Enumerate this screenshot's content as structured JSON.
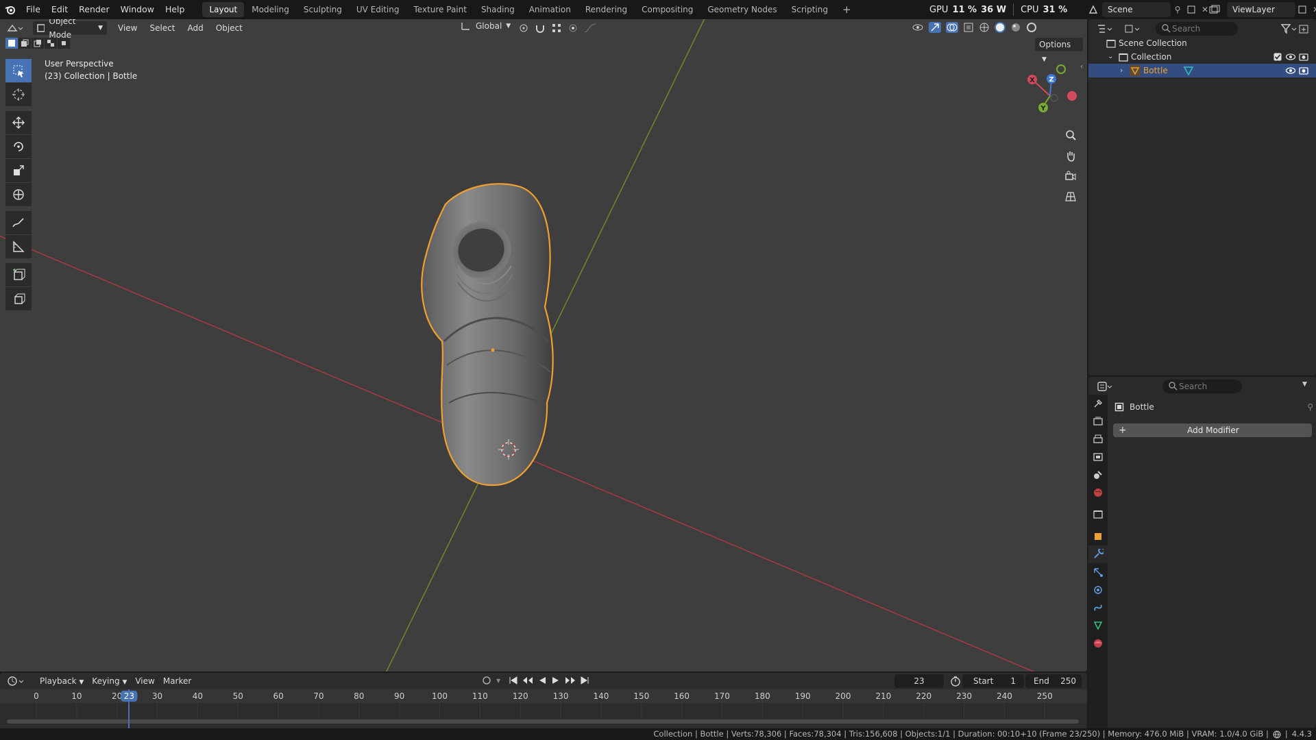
{
  "app": {
    "menus": [
      "File",
      "Edit",
      "Render",
      "Window",
      "Help"
    ],
    "workspaces": [
      "Layout",
      "Modeling",
      "Sculpting",
      "UV Editing",
      "Texture Paint",
      "Shading",
      "Animation",
      "Rendering",
      "Compositing",
      "Geometry Nodes",
      "Scripting"
    ],
    "active_workspace": "Layout",
    "add_workspace": "+",
    "gpu_label": "GPU",
    "gpu_value": "11 %",
    "gpu_power": "36 W",
    "cpu_label": "CPU",
    "cpu_value": "31 %",
    "scene": "Scene",
    "view_layer": "ViewLayer"
  },
  "viewport": {
    "mode": "Object Mode",
    "menus": [
      "View",
      "Select",
      "Add",
      "Object"
    ],
    "orientation": "Global",
    "options": "Options",
    "perspective_label": "User Perspective",
    "context_label": "(23) Collection | Bottle",
    "axis_x_color": "#a83a44",
    "axis_y_color": "#6a8a2a",
    "selection_outline": "#f0a030",
    "gizmo": {
      "x": "X",
      "y": "Y",
      "z": "Z"
    }
  },
  "tools": [
    "select-box-icon",
    "cursor-icon",
    "move-icon",
    "rotate-icon",
    "scale-icon",
    "transform-icon",
    "annotate-icon",
    "measure-icon",
    "add-cube-icon",
    "primitive-icon"
  ],
  "timeline": {
    "menus": [
      "Playback",
      "Keying",
      "View",
      "Marker"
    ],
    "current_frame": "23",
    "start_label": "Start",
    "start_value": "1",
    "end_label": "End",
    "end_value": "250",
    "ticks": [
      "0",
      "10",
      "20",
      "30",
      "40",
      "50",
      "60",
      "70",
      "80",
      "90",
      "100",
      "110",
      "120",
      "130",
      "140",
      "150",
      "160",
      "170",
      "180",
      "190",
      "200",
      "210",
      "220",
      "230",
      "240",
      "250"
    ]
  },
  "outliner": {
    "search_placeholder": "Search",
    "scene_collection": "Scene Collection",
    "collection": "Collection",
    "object": "Bottle"
  },
  "properties": {
    "search_placeholder": "Search",
    "object_name": "Bottle",
    "add_modifier": "Add Modifier",
    "add_modifier_plus": "+"
  },
  "status": {
    "text": "Collection | Bottle | Verts:78,306 | Faces:78,304 | Tris:156,608 | Objects:1/1 | Duration: 00:10+10 (Frame 23/250) | Memory: 476.0 MiB | VRAM: 1.0/4.0 GiB |",
    "version": "4.4.3"
  }
}
